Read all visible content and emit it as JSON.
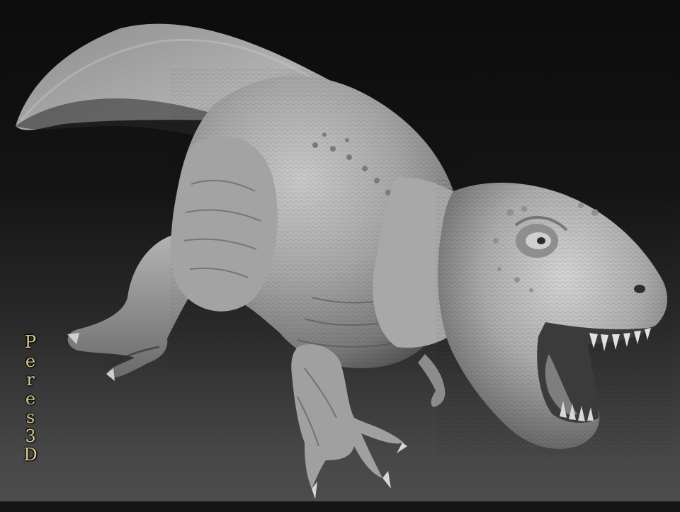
{
  "watermark": {
    "text": "Peres 3D",
    "lines": [
      "P",
      "e",
      "r",
      "e",
      "s",
      "3",
      "D"
    ]
  },
  "colors": {
    "background_top": "#0c0c0c",
    "background_bottom": "#4c4c4c",
    "watermark": "#d8c98f",
    "sculpt_clay": "#9a9a9a"
  },
  "subject": {
    "icon": "t-rex-sculpt-render"
  }
}
